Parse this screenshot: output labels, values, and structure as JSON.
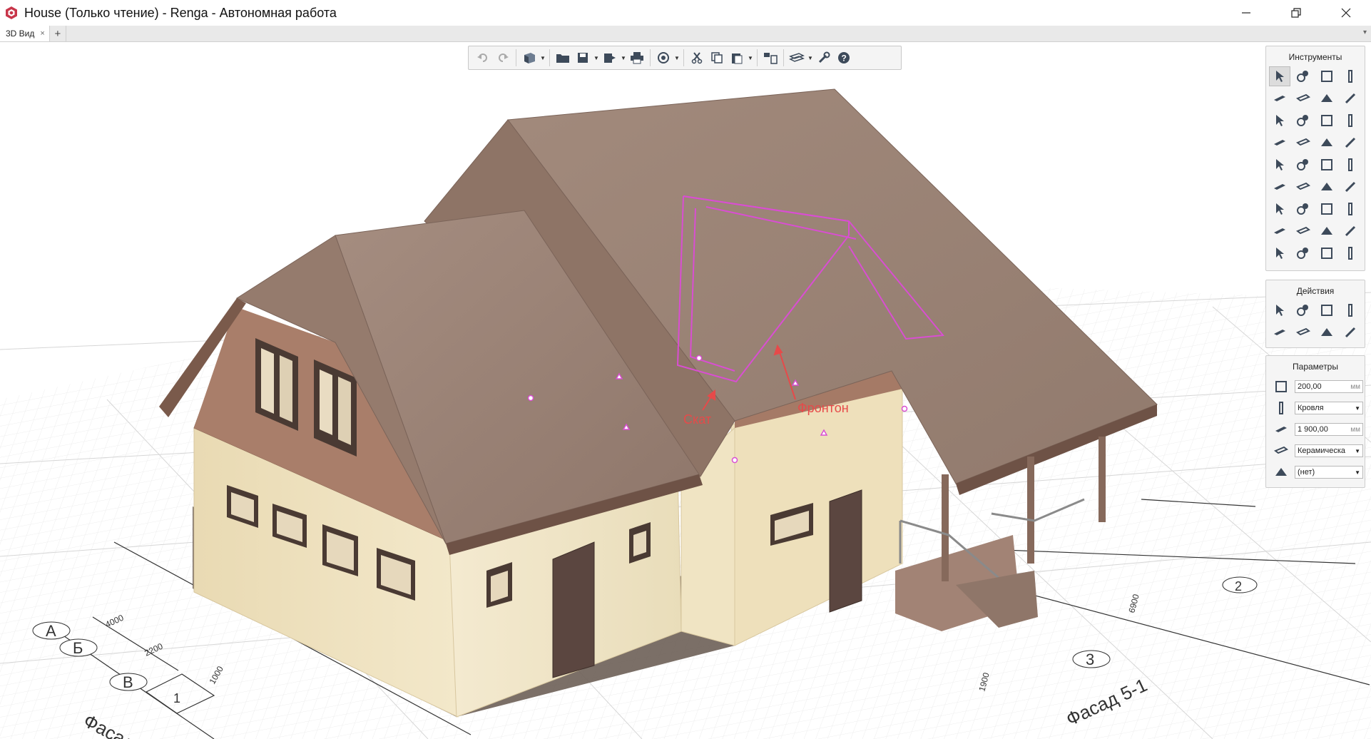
{
  "window": {
    "title": "House (Только чтение) - Renga - Автономная работа",
    "controls": [
      "minimize-icon",
      "maximize-icon",
      "close-icon"
    ]
  },
  "tabs": [
    {
      "label": "3D Вид",
      "close": "×"
    }
  ],
  "tab_add": "+",
  "tab_menu": "▾",
  "toolbar": {
    "buttons": [
      "undo-icon",
      "redo-icon",
      "view-cube-icon",
      "open-folder-icon",
      "save-icon",
      "export-icon",
      "print-icon",
      "orbit-icon",
      "cut-icon",
      "copy-icon",
      "paste-icon",
      "properties-icon",
      "layers-icon",
      "settings-wrench-icon",
      "help-icon"
    ]
  },
  "tools_panel": {
    "title": "Инструменты",
    "tools": [
      "select-icon",
      "assembly-icon",
      "wall-icon",
      "column-icon",
      "slab-icon",
      "floor-icon",
      "roof-icon",
      "beam-icon",
      "stair-icon",
      "ramp-icon",
      "door-icon",
      "window-icon",
      "railing-icon",
      "line-icon",
      "plumbing-icon",
      "duct-icon",
      "equipment-icon",
      "boiler-icon",
      "fan-icon",
      "pipe-icon",
      "valve-icon",
      "pump-icon",
      "tank-icon",
      "fitting-icon",
      "heater-icon",
      "lamp-icon",
      "cable-icon",
      "panel-icon",
      "cabinet-icon",
      "light-icon",
      "outlet-icon",
      "socket-icon",
      "dimension-icon",
      "level-icon",
      "hatch-icon",
      "text-icon"
    ]
  },
  "actions_panel": {
    "title": "Действия",
    "actions": [
      "move-icon",
      "array-icon",
      "copy-line-icon",
      "mirror-icon",
      "rotate-icon",
      "scale-icon",
      "align-icon",
      "trim-icon"
    ]
  },
  "params_panel": {
    "title": "Параметры",
    "rows": [
      {
        "icon": "thickness-icon",
        "value": "200,00",
        "unit": "мм",
        "dropdown": false
      },
      {
        "icon": "roof-type-icon",
        "value": "Кровля",
        "unit": "",
        "dropdown": true
      },
      {
        "icon": "height-icon",
        "value": "1 900,00",
        "unit": "мм",
        "dropdown": false
      },
      {
        "icon": "material-icon",
        "value": "Керамическа",
        "unit": "",
        "dropdown": true
      },
      {
        "icon": "label-icon",
        "value": "(нет)",
        "unit": "",
        "dropdown": true
      }
    ]
  },
  "annotations": {
    "skat": "Скат",
    "fronton": "Фронтон"
  },
  "drawing_labels": {
    "facade_left": "Фасад А",
    "facade_right": "Фасад 5-1",
    "axes": [
      "А",
      "Б",
      "В",
      "1",
      "2",
      "3"
    ],
    "dims": [
      "4000",
      "2200",
      "1900",
      "6900",
      "1000"
    ]
  },
  "colors": {
    "roof": "#9a8274",
    "roof_dark": "#86695b",
    "gable": "#a97e6a",
    "wall": "#efe2bf",
    "frame": "#4d3d36",
    "selection": "#d94ed2",
    "annotation": "#e64a4a",
    "grid": "#e3e3e3"
  }
}
